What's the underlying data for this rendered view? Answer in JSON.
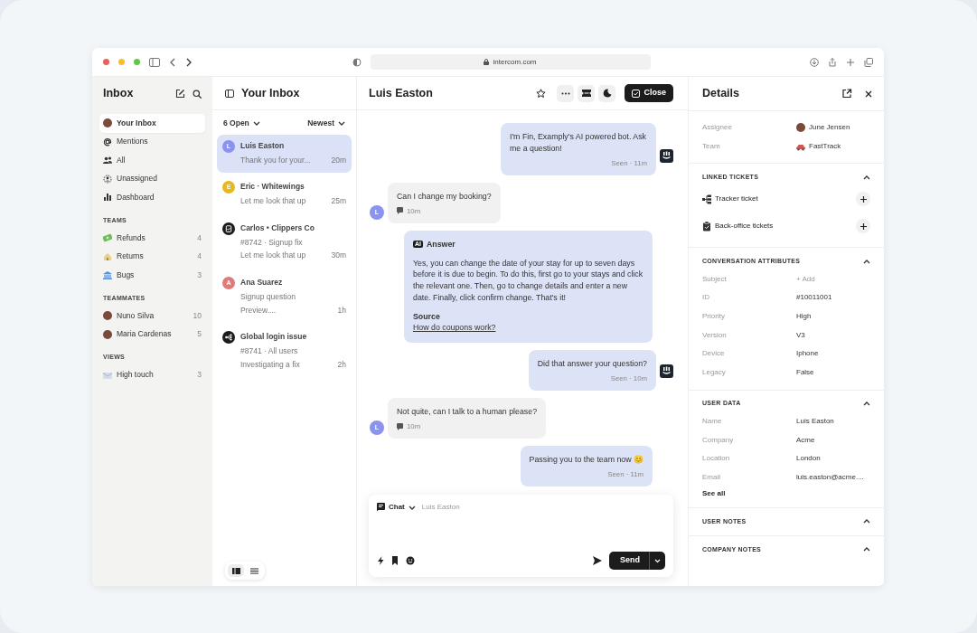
{
  "browser": {
    "url": "intercom.com"
  },
  "sidebar": {
    "title": "Inbox",
    "groups": [
      {
        "items": [
          {
            "label": "Your Inbox",
            "kind": "avatar",
            "selected": true
          },
          {
            "label": "Mentions",
            "kind": "mention",
            "selected": false
          },
          {
            "label": "All",
            "kind": "people",
            "selected": false
          },
          {
            "label": "Unassigned",
            "kind": "unassigned",
            "selected": false
          },
          {
            "label": "Dashboard",
            "kind": "chart",
            "selected": false
          }
        ]
      },
      {
        "heading": "TEAMS",
        "items": [
          {
            "label": "Refunds",
            "count": "4",
            "kind": "money",
            "selected": false
          },
          {
            "label": "Returns",
            "count": "4",
            "kind": "house",
            "selected": false
          },
          {
            "label": "Bugs",
            "count": "3",
            "kind": "bank",
            "selected": false
          }
        ]
      },
      {
        "heading": "TEAMMATES",
        "items": [
          {
            "label": "Nuno Silva",
            "count": "10",
            "kind": "avatar",
            "selected": false
          },
          {
            "label": "Maria Cardenas",
            "count": "5",
            "kind": "avatar",
            "selected": false
          }
        ]
      },
      {
        "heading": "VIEWS",
        "items": [
          {
            "label": "High touch",
            "count": "3",
            "kind": "mail",
            "selected": false
          }
        ]
      }
    ]
  },
  "inbox": {
    "title": "Your Inbox",
    "filter": "6 Open",
    "sort": "Newest",
    "conversations": [
      {
        "name": "Luis Easton",
        "kind": "letter",
        "letter": "L",
        "color": "#8b93f0",
        "lines": [
          "Thank you for your..."
        ],
        "time": "20m",
        "selected": true
      },
      {
        "name": "Eric · Whitewings",
        "kind": "letter",
        "letter": "E",
        "color": "#e8b81c",
        "lines": [
          "Let me look that up"
        ],
        "time": "25m",
        "selected": false
      },
      {
        "name": "Carlos • Clippers Co",
        "kind": "ticket",
        "lines": [
          "#8742  · Signup fix",
          "Let me look that up"
        ],
        "time": "30m",
        "selected": false
      },
      {
        "name": "Ana Suarez",
        "kind": "letter",
        "letter": "A",
        "color": "#e07b7b",
        "lines": [
          "Signup question",
          "Preview...."
        ],
        "time": "1h",
        "selected": false
      },
      {
        "name": "Global login issue",
        "kind": "tracker",
        "lines": [
          "#8741 · All users",
          "Investigating a fix"
        ],
        "time": "2h",
        "selected": false
      }
    ],
    "views": [
      {
        "kind": "split",
        "selected": true
      },
      {
        "kind": "list",
        "selected": false
      }
    ]
  },
  "conversation": {
    "title": "Luis Easton",
    "close_label": "Close",
    "messages": [
      {
        "kind": "bot",
        "text": "I'm Fin, Examply's AI powered bot. Ask me a question!",
        "meta": "Seen · 11m"
      },
      {
        "kind": "user",
        "letter": "L",
        "text": "Can I change my booking?",
        "meta": "10m"
      },
      {
        "kind": "answer",
        "badge": "AI",
        "label": "Answer",
        "text": "Yes, you can change the date of your stay for up to seven days before it is due to begin. To do this, first go to your stays and click the relevant one. Then, go to change details and enter a new date. Finally, click confirm change. That's it!",
        "source_label": "Source",
        "source_link": "How do coupons work?"
      },
      {
        "kind": "bot",
        "text": "Did that answer your question?",
        "meta": "Seen · 10m"
      },
      {
        "kind": "user",
        "letter": "L",
        "text": "Not quite, can I talk to a human please?",
        "meta": "10m"
      },
      {
        "kind": "agent",
        "text": "Passing you to the team now 😊",
        "meta": "Seen · 11m"
      }
    ],
    "composer": {
      "channel": "Chat",
      "recipient": "Luis Easton",
      "send_label": "Send"
    }
  },
  "details": {
    "title": "Details",
    "people": [
      {
        "label": "Assignee",
        "value": "June Jensen",
        "kind": "avatar"
      },
      {
        "label": "Team",
        "value": "FastTrack",
        "kind": "car"
      }
    ],
    "sections": [
      {
        "heading": "LINKED TICKETS",
        "expanded": true,
        "kind": "tickets",
        "items": [
          {
            "label": "Tracker ticket",
            "kind": "tracker"
          },
          {
            "label": "Back-office tickets",
            "kind": "clipboard"
          }
        ]
      },
      {
        "heading": "CONVERSATION ATTRIBUTES",
        "expanded": true,
        "kind": "attributes",
        "rows": [
          {
            "label": "Subject",
            "value": "+ Add",
            "muted": true
          },
          {
            "label": "ID",
            "value": "#10011001",
            "muted": false
          },
          {
            "label": "Priority",
            "value": "High",
            "muted": false
          },
          {
            "label": "Version",
            "value": "V3",
            "muted": false
          },
          {
            "label": "Device",
            "value": "Iphone",
            "muted": false
          },
          {
            "label": "Legacy",
            "value": "False",
            "muted": false
          }
        ]
      },
      {
        "heading": "USER DATA",
        "expanded": true,
        "kind": "attributes",
        "rows": [
          {
            "label": "Name",
            "value": "Luis Easton",
            "muted": false
          },
          {
            "label": "Company",
            "value": "Acme",
            "muted": false
          },
          {
            "label": "Location",
            "value": "London",
            "muted": false
          },
          {
            "label": "Email",
            "value": "luis.easton@acme....",
            "muted": false
          }
        ],
        "link": "See all"
      },
      {
        "heading": "USER NOTES",
        "expanded": true,
        "kind": "notes"
      },
      {
        "heading": "COMPANY NOTES",
        "expanded": true,
        "kind": "notes"
      }
    ]
  }
}
